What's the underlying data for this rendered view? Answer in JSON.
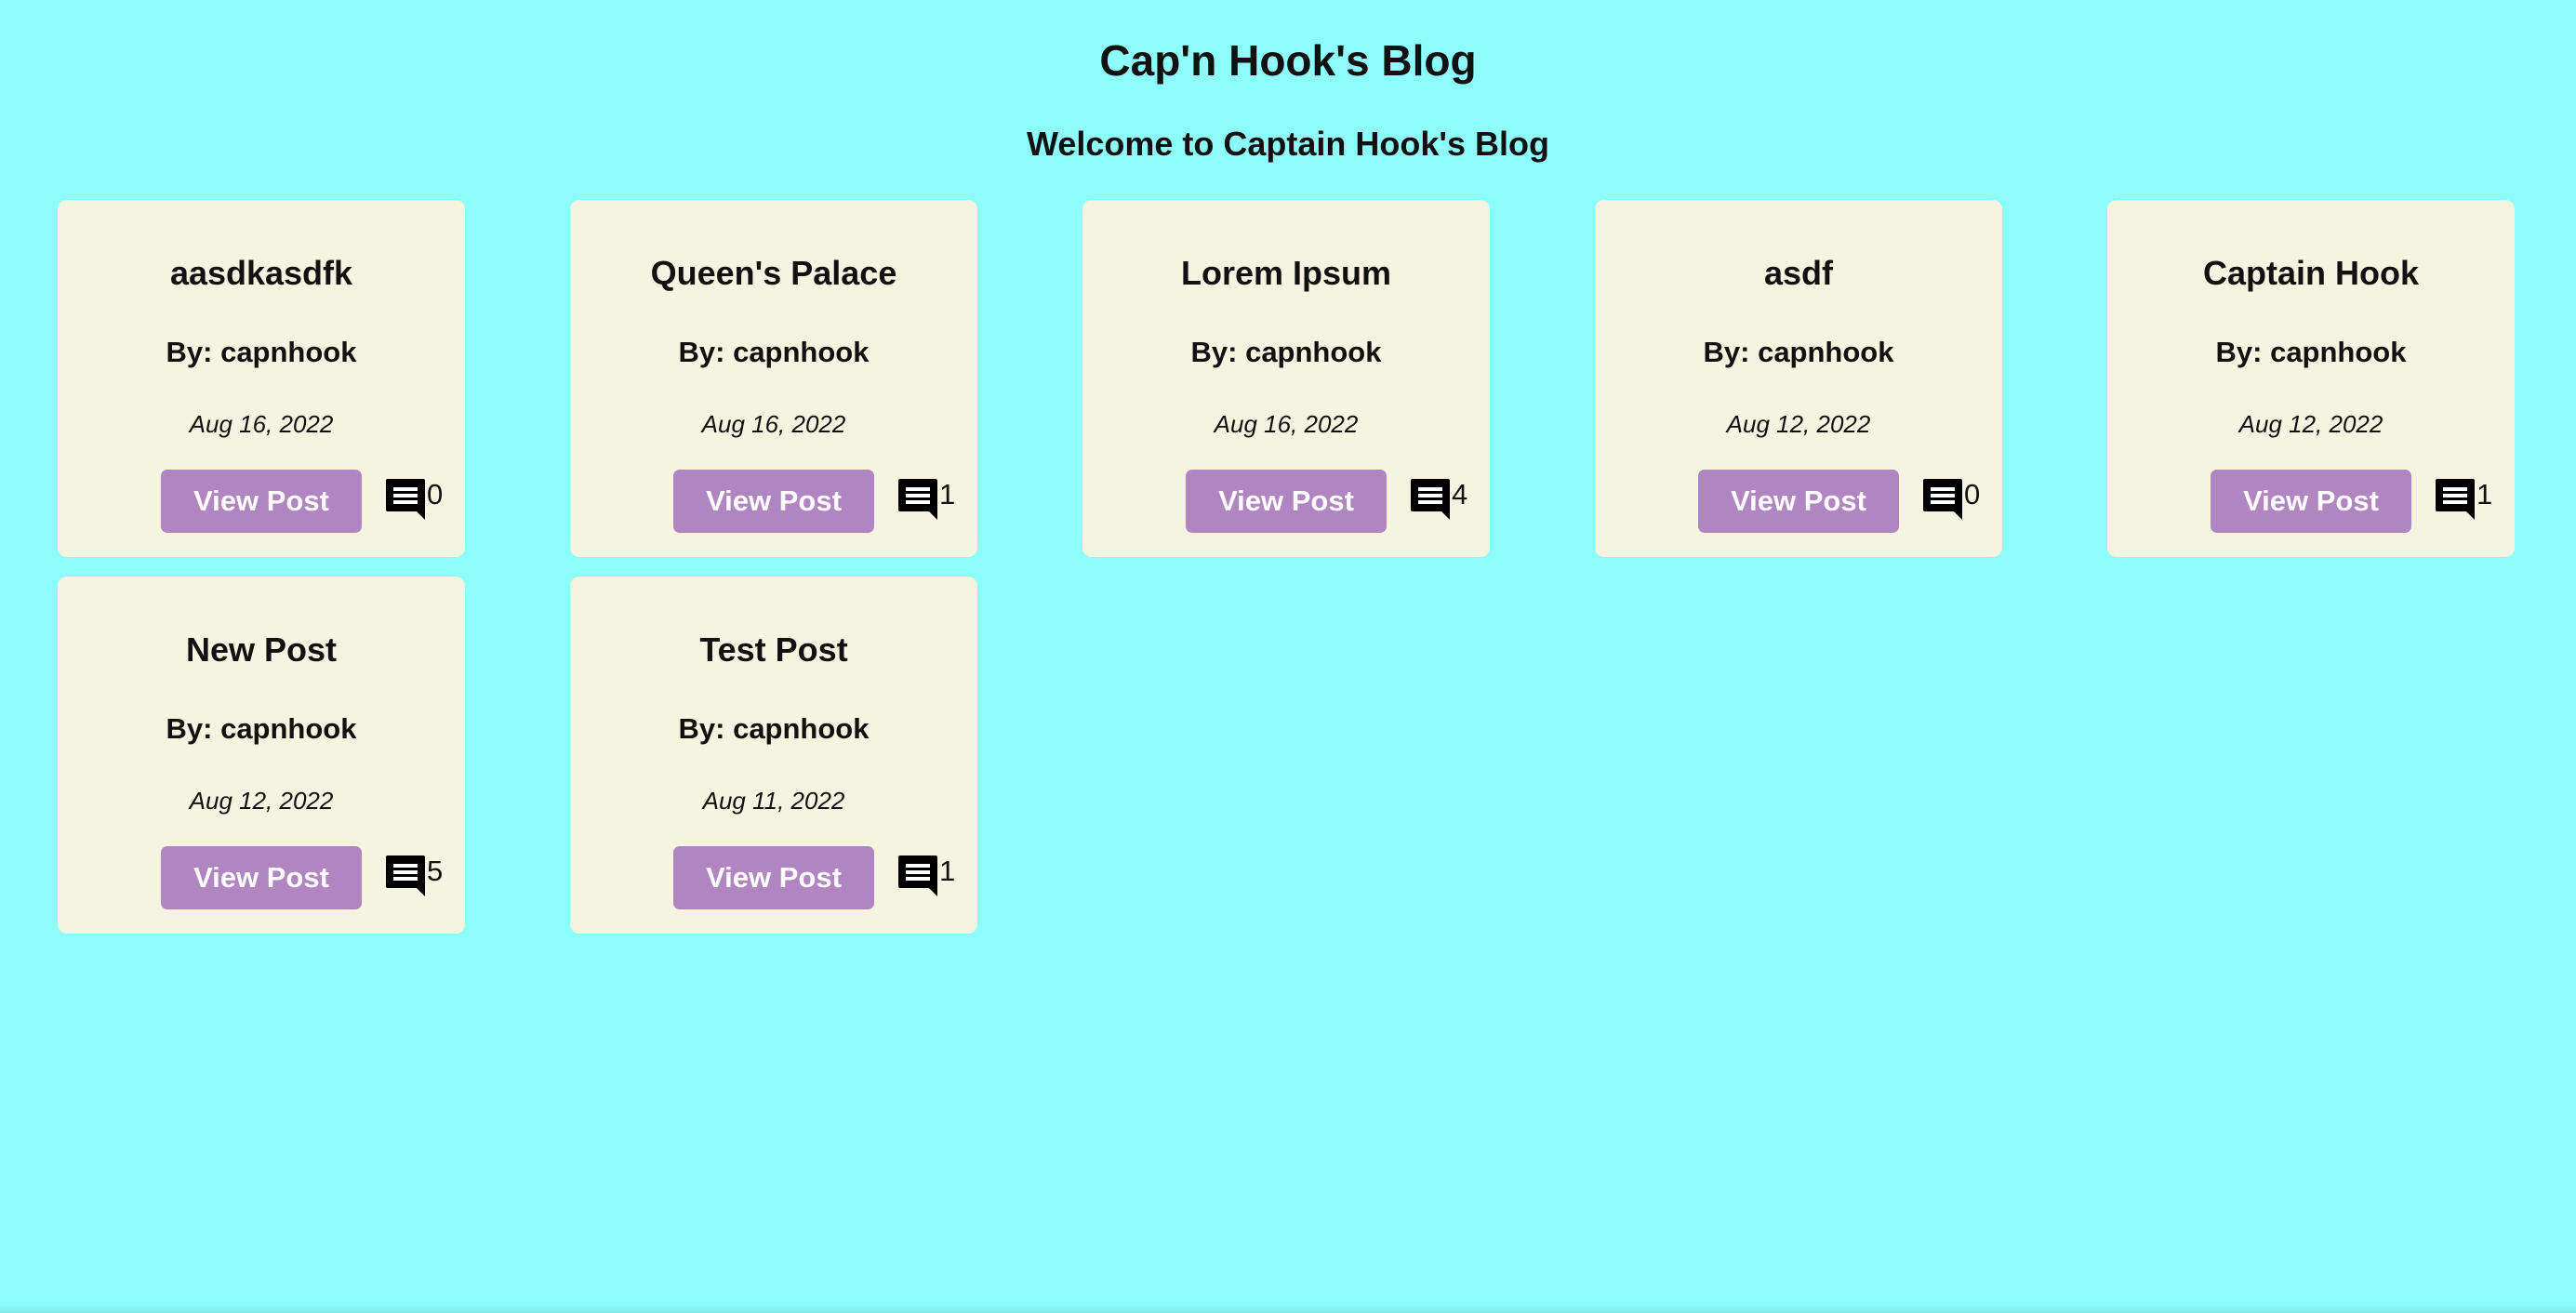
{
  "header": {
    "title": "Cap'n Hook's Blog",
    "welcome": "Welcome to Captain Hook's Blog"
  },
  "icons": {
    "comment": "comment-icon"
  },
  "colors": {
    "background": "#8cfdfb",
    "card": "#f5f4e0",
    "button": "#b185c1",
    "button_text": "#ffffff"
  },
  "posts": [
    {
      "title": "aasdkasdfk",
      "author": "By: capnhook",
      "date": "Aug 16, 2022",
      "button": "View Post",
      "comments": "0"
    },
    {
      "title": "Queen's Palace",
      "author": "By: capnhook",
      "date": "Aug 16, 2022",
      "button": "View Post",
      "comments": "1"
    },
    {
      "title": "Lorem Ipsum",
      "author": "By: capnhook",
      "date": "Aug 16, 2022",
      "button": "View Post",
      "comments": "4"
    },
    {
      "title": "asdf",
      "author": "By: capnhook",
      "date": "Aug 12, 2022",
      "button": "View Post",
      "comments": "0"
    },
    {
      "title": "Captain Hook",
      "author": "By: capnhook",
      "date": "Aug 12, 2022",
      "button": "View Post",
      "comments": "1"
    },
    {
      "title": "New Post",
      "author": "By: capnhook",
      "date": "Aug 12, 2022",
      "button": "View Post",
      "comments": "5"
    },
    {
      "title": "Test Post",
      "author": "By: capnhook",
      "date": "Aug 11, 2022",
      "button": "View Post",
      "comments": "1"
    }
  ]
}
